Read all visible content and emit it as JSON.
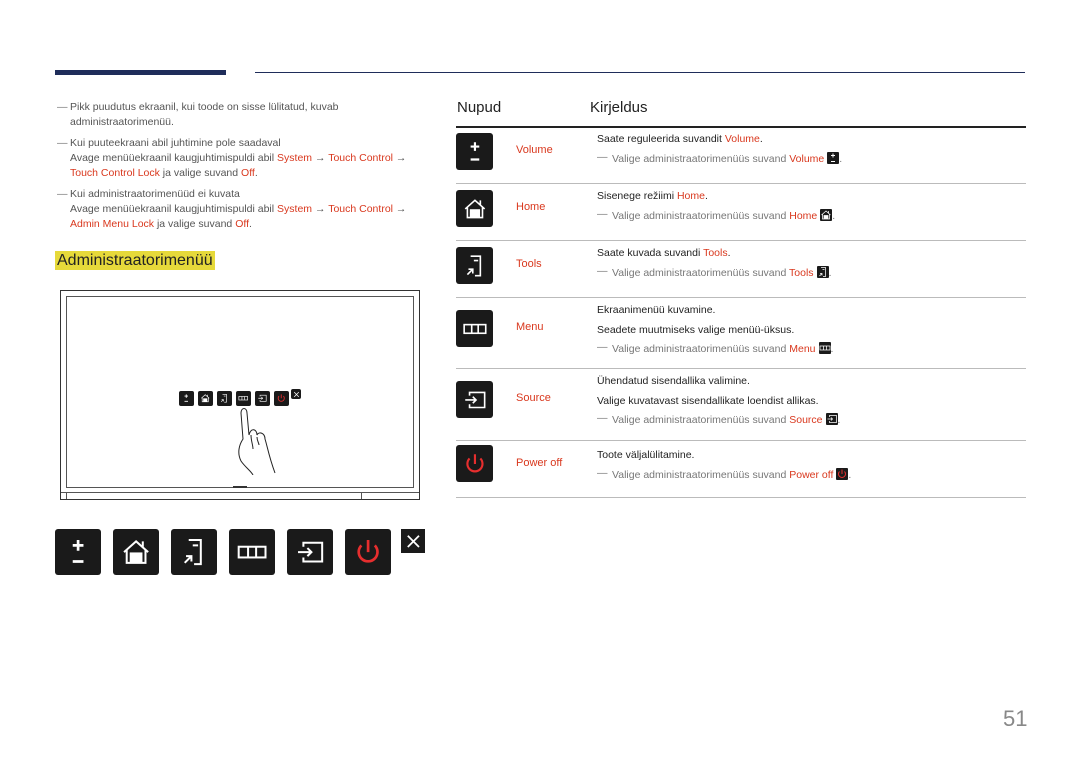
{
  "notes": [
    {
      "lines": [
        [
          {
            "t": "Pikk puudutus ekraanil, kui toode on sisse lülitatud, kuvab administraatorimenüü."
          }
        ]
      ]
    },
    {
      "lines": [
        [
          {
            "t": "Kui puuteekraani abil juhtimine pole saadaval"
          }
        ],
        [
          {
            "t": "Avage menüüekraanil kaugjuhtimispuldi abil "
          },
          {
            "t": "System",
            "r": true
          },
          {
            "t": " → "
          },
          {
            "t": "Touch Control",
            "r": true
          },
          {
            "t": " → "
          },
          {
            "t": "Touch Control Lock",
            "r": true
          },
          {
            "t": " ja valige suvand "
          },
          {
            "t": "Off",
            "r": true
          },
          {
            "t": "."
          }
        ]
      ]
    },
    {
      "lines": [
        [
          {
            "t": "Kui administraatorimenüüd ei kuvata"
          }
        ],
        [
          {
            "t": "Avage menüüekraanil kaugjuhtimispuldi abil "
          },
          {
            "t": "System",
            "r": true
          },
          {
            "t": " → "
          },
          {
            "t": "Touch Control",
            "r": true
          },
          {
            "t": " → "
          },
          {
            "t": "Admin Menu Lock",
            "r": true
          },
          {
            "t": " ja valige suvand "
          },
          {
            "t": "Off",
            "r": true
          },
          {
            "t": "."
          }
        ]
      ]
    }
  ],
  "section_heading": "Administraatorimenüü",
  "menu_icons": [
    "volume",
    "home",
    "tools",
    "menu",
    "source",
    "power",
    "close"
  ],
  "table": {
    "col_buttons": "Nupud",
    "col_description": "Kirjeldus",
    "rows": [
      {
        "icon": "volume",
        "label": "Volume",
        "lines": [
          "Saate reguleerida suvandit |Volume|."
        ],
        "note": [
          "Valige administraatorimenüüs suvand ",
          "Volume"
        ]
      },
      {
        "icon": "home",
        "label": "Home",
        "lines": [
          "Sisenege režiimi |Home|."
        ],
        "note": [
          "Valige administraatorimenüüs suvand ",
          "Home"
        ]
      },
      {
        "icon": "tools",
        "label": "Tools",
        "lines": [
          "Saate kuvada suvandi |Tools|."
        ],
        "note": [
          "Valige administraatorimenüüs suvand ",
          "Tools"
        ]
      },
      {
        "icon": "menu",
        "label": "Menu",
        "lines": [
          "Ekraanimenüü kuvamine.",
          "Seadete muutmiseks valige menüü-üksus."
        ],
        "note": [
          "Valige administraatorimenüüs suvand ",
          "Menu"
        ]
      },
      {
        "icon": "source",
        "label": "Source",
        "lines": [
          "Ühendatud sisendallika valimine.",
          "Valige kuvatavast sisendallikate loendist allikas."
        ],
        "note": [
          "Valige administraatorimenüüs suvand ",
          "Source"
        ]
      },
      {
        "icon": "power",
        "label": "Power off",
        "lines": [
          "Toote väljalülitamine."
        ],
        "note": [
          "Valige administraatorimenüüs suvand ",
          "Power off"
        ]
      }
    ]
  },
  "page_number": "51",
  "colors": {
    "accent_red": "#d9381e",
    "highlight": "#e6d93a",
    "rule": "#1f2d5a",
    "icon_bg": "#1a1a1a"
  }
}
